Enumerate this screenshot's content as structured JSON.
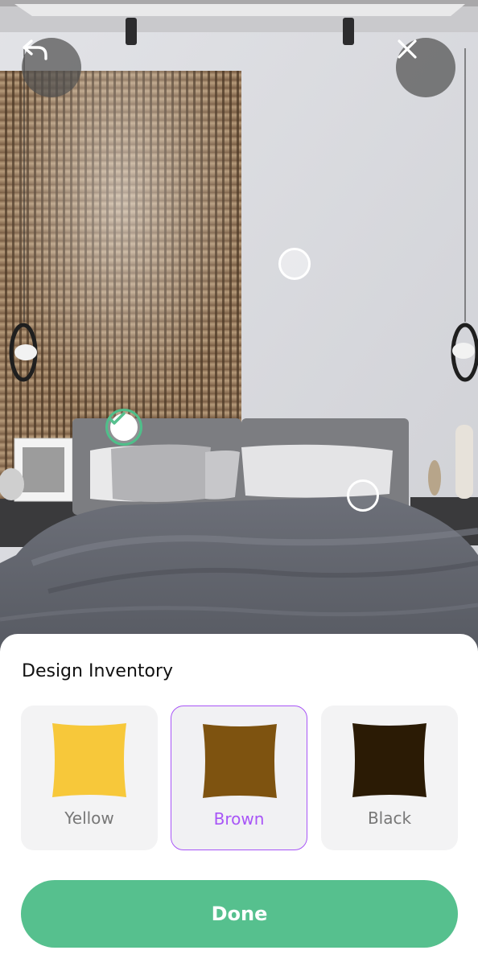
{
  "scene": {
    "back_icon": "undo-arrow-icon",
    "close_icon": "close-icon",
    "selected_hotspot_icon": "checkmark-icon"
  },
  "sheet": {
    "title": "Design Inventory",
    "options": [
      {
        "label": "Yellow",
        "color": "#f7c83a",
        "selected": false
      },
      {
        "label": "Brown",
        "color": "#7e5310",
        "selected": true
      },
      {
        "label": "Black",
        "color": "#2b1b05",
        "selected": false
      }
    ],
    "done_label": "Done"
  },
  "colors": {
    "accent_green": "#56c08e",
    "selected_purple": "#a855f7"
  }
}
